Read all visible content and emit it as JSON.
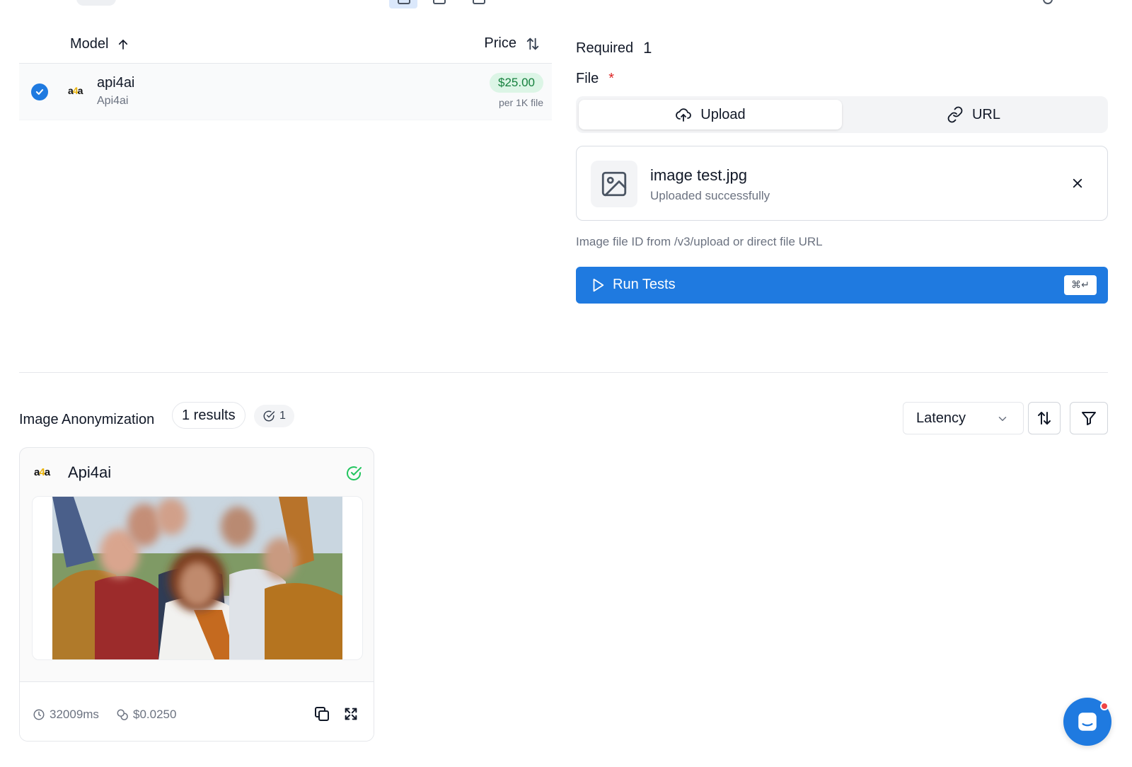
{
  "model_table": {
    "col_model": "Model",
    "col_price": "Price",
    "rows": [
      {
        "logo_text_left": "a",
        "logo_text_mid": "4",
        "logo_text_right": "a",
        "name": "api4ai",
        "provider": "Api4ai",
        "price": "$25.00",
        "price_unit": "per 1K file",
        "selected": true
      }
    ]
  },
  "form": {
    "required_label": "Required",
    "required_count": "1",
    "file_label": "File",
    "required_star": "*",
    "tabs": {
      "upload": "Upload",
      "url": "URL"
    },
    "file": {
      "name": "image test.jpg",
      "status": "Uploaded successfully"
    },
    "hint": "Image file ID from /v3/upload or direct file URL",
    "run_button": "Run Tests",
    "shortcut": "⌘↵"
  },
  "results": {
    "title": "Image Anonymization",
    "count": "1 results",
    "success_count": "1",
    "sort_by": "Latency",
    "cards": [
      {
        "name": "Api4ai",
        "logo_left": "a",
        "logo_mid": "4",
        "logo_right": "a",
        "latency": "32009ms",
        "cost": "$0.0250",
        "status": "success"
      }
    ]
  },
  "colors": {
    "accent": "#1f7ae0",
    "success": "#22c55e",
    "price_bg": "#dcf5e6",
    "price_text": "#15803d",
    "danger": "#dc2626"
  },
  "icons": [
    "sort-asc-icon",
    "sort-both-icon",
    "check-icon",
    "upload-cloud-icon",
    "link-icon",
    "image-icon",
    "close-icon",
    "play-icon",
    "check-circle-icon",
    "chevron-down-icon",
    "filter-icon",
    "clock-icon",
    "coins-icon",
    "copy-icon",
    "expand-icon",
    "chat-icon"
  ]
}
